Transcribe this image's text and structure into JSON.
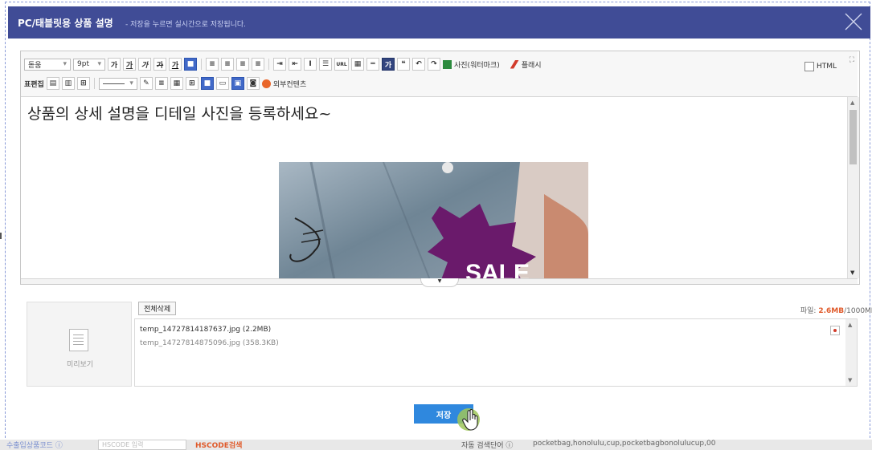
{
  "modal": {
    "title": "PC/태블릿용 상품 설명",
    "subtitle": "- 저장을 누르면 실시간으로 저장됩니다."
  },
  "toolbar": {
    "font_family": "돋움",
    "font_size": "9pt",
    "btn_bold": "가",
    "btn_underline": "가",
    "btn_italic": "가",
    "btn_strike": "가",
    "btn_color": "가",
    "btn_url": "URL",
    "btn_quote": "❝",
    "btn_special": "가",
    "photo_label": "사진(워터마크)",
    "flash_label": "플래시",
    "html_label": "HTML",
    "table_label": "표편집",
    "external_label": "외부컨텐츠"
  },
  "editor": {
    "heading": "상품의 상세 설명을 디테일 사진을 등록하세요~",
    "sale_text": "SALE"
  },
  "attachments": {
    "delete_all": "전체삭제",
    "quota_prefix": "파일: ",
    "quota_used": "2.6MB",
    "quota_total": "/1000MB",
    "preview_label": "미리보기",
    "files": [
      "temp_14727814187637.jpg (2.2MB)",
      "temp_14727814875096.jpg (358.3KB)"
    ]
  },
  "save_label": "저장",
  "bottom_bar": {
    "hscode_label": "수출입상품코드 ⓘ",
    "hscode_placeholder": "HSCODE 입력",
    "hscode_search": "HSCODE검색",
    "auto_keyword": "자동 검색단어 ⓘ",
    "keyword_text": "pocketbag,honolulu,cup,pocketbagbonolulucup,00"
  },
  "colors": {
    "header": "#404c96",
    "save_button": "#2f88de",
    "quota_used": "#e05a2a"
  }
}
